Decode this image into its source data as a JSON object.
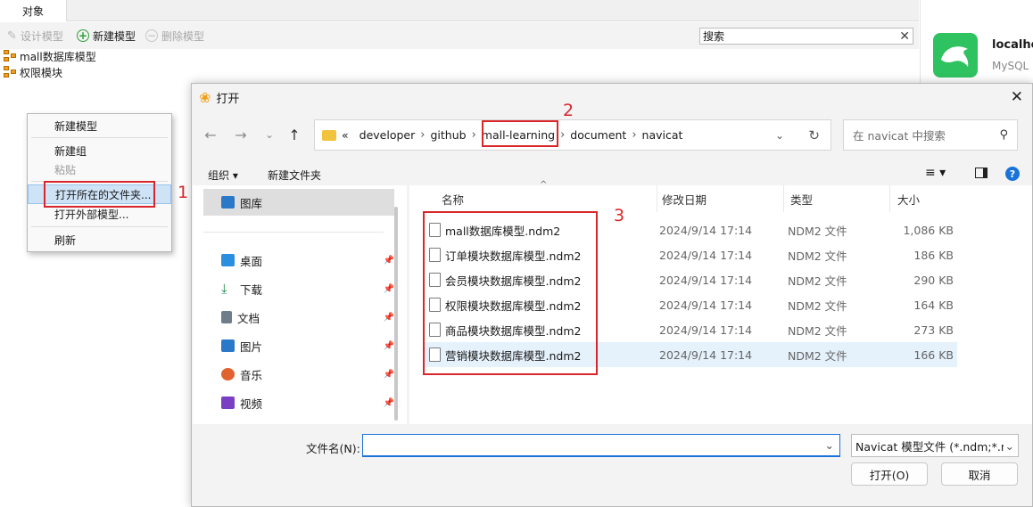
{
  "bg": {
    "tab_label": "对象",
    "toolbar": {
      "design": "设计模型",
      "new": "新建模型",
      "delete": "删除模型"
    },
    "search_label": "搜索",
    "tree": [
      "mall数据库模型",
      "权限模块"
    ],
    "connection": {
      "name": "localhost",
      "type": "MySQL"
    }
  },
  "context_menu": {
    "items": [
      {
        "label": "新建模型",
        "disabled": false
      },
      {
        "label": "新建组",
        "disabled": false
      },
      {
        "label": "粘贴",
        "disabled": true
      },
      {
        "label": "打开所在的文件夹...",
        "disabled": false
      },
      {
        "label": "打开外部模型...",
        "disabled": false
      },
      {
        "label": "刷新",
        "disabled": false
      }
    ]
  },
  "annotations": {
    "n1": "1",
    "n2": "2",
    "n3": "3"
  },
  "dialog": {
    "title": "打开",
    "breadcrumb": [
      "«",
      "developer",
      "github",
      "mall-learning",
      "document",
      "navicat"
    ],
    "search_placeholder": "在 navicat 中搜索",
    "organize": "组织 ▾",
    "new_folder": "新建文件夹",
    "sidebar": [
      {
        "label": "图库",
        "color": "#2a78c8",
        "pinned": false
      },
      {
        "label": "桌面",
        "color": "#2b8fe0",
        "pinned": true
      },
      {
        "label": "下载",
        "color": "#1f8a4c",
        "pinned": true
      },
      {
        "label": "文档",
        "color": "#6f7c8a",
        "pinned": true
      },
      {
        "label": "图片",
        "color": "#2a78c8",
        "pinned": true
      },
      {
        "label": "音乐",
        "color": "#e0632f",
        "pinned": true
      },
      {
        "label": "视频",
        "color": "#7b3fc4",
        "pinned": true
      }
    ],
    "columns": {
      "name": "名称",
      "date": "修改日期",
      "type": "类型",
      "size": "大小"
    },
    "files": [
      {
        "name": "mall数据库模型.ndm2",
        "date": "2024/9/14 17:14",
        "type": "NDM2 文件",
        "size": "1,086 KB"
      },
      {
        "name": "订单模块数据库模型.ndm2",
        "date": "2024/9/14 17:14",
        "type": "NDM2 文件",
        "size": "186 KB"
      },
      {
        "name": "会员模块数据库模型.ndm2",
        "date": "2024/9/14 17:14",
        "type": "NDM2 文件",
        "size": "290 KB"
      },
      {
        "name": "权限模块数据库模型.ndm2",
        "date": "2024/9/14 17:14",
        "type": "NDM2 文件",
        "size": "164 KB"
      },
      {
        "name": "商品模块数据库模型.ndm2",
        "date": "2024/9/14 17:14",
        "type": "NDM2 文件",
        "size": "273 KB"
      },
      {
        "name": "营销模块数据库模型.ndm2",
        "date": "2024/9/14 17:14",
        "type": "NDM2 文件",
        "size": "166 KB"
      }
    ],
    "filename_label": "文件名(N):",
    "filename_value": "",
    "filetype": "Navicat 模型文件 (*.ndm;*.nd",
    "open_button": "打开(O)",
    "cancel_button": "取消"
  }
}
